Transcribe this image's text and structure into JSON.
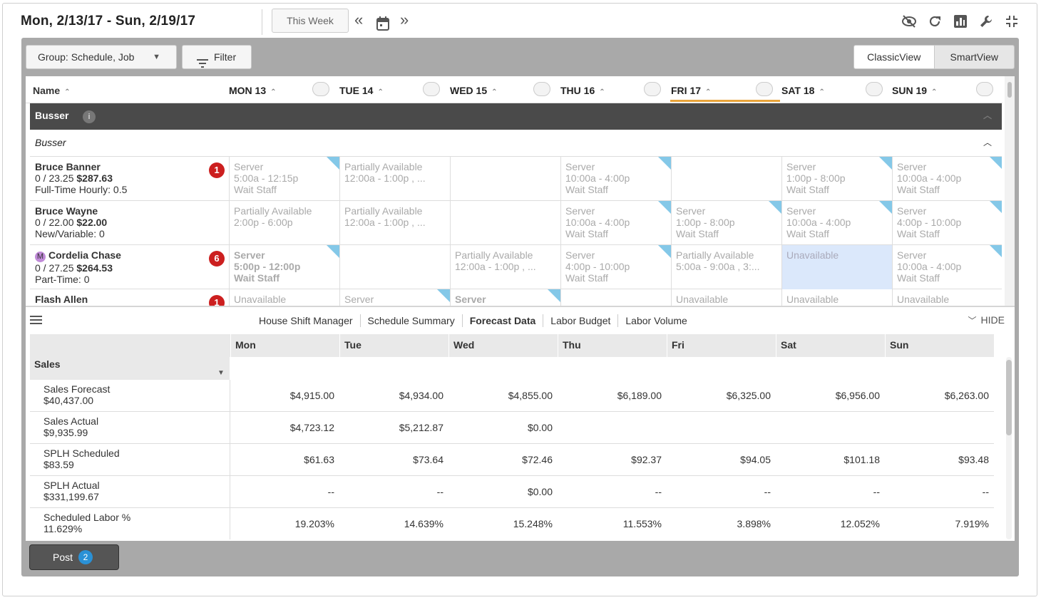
{
  "header": {
    "date_range": "Mon, 2/13/17 - Sun, 2/19/17",
    "this_week": "This Week",
    "prev_icon": "«",
    "next_icon": "»"
  },
  "toolbar": {
    "group_label": "Group: Schedule, Job",
    "filter_label": "Filter",
    "classic_view": "ClassicView",
    "smart_view": "SmartView"
  },
  "schedule": {
    "name_header": "Name",
    "days": [
      "MON 13",
      "TUE 14",
      "WED 15",
      "THU 16",
      "FRI 17",
      "SAT 18",
      "SUN 19"
    ],
    "group_title": "Busser",
    "subgroup_title": "Busser",
    "employees": [
      {
        "name": "Bruce Banner",
        "hours": "0 / 23.25",
        "cost": "$287.63",
        "type": "Full-Time Hourly: 0.5",
        "badge": "1",
        "manager": "",
        "cells": [
          {
            "l1": "Server",
            "l2": "5:00a - 12:15p",
            "l3": "Wait Staff",
            "corner": true
          },
          {
            "l1": "Partially Available",
            "l2": "12:00a - 1:00p , ...",
            "l3": ""
          },
          {
            "l1": "",
            "l2": "",
            "l3": ""
          },
          {
            "l1": "Server",
            "l2": "10:00a - 4:00p",
            "l3": "Wait Staff",
            "corner": true
          },
          {
            "l1": "",
            "l2": "",
            "l3": ""
          },
          {
            "l1": "Server",
            "l2": "1:00p - 8:00p",
            "l3": "Wait Staff",
            "corner": true
          },
          {
            "l1": "Server",
            "l2": "10:00a - 4:00p",
            "l3": "Wait Staff",
            "corner": true
          }
        ]
      },
      {
        "name": "Bruce Wayne",
        "hours": "0 / 22.00",
        "cost": "$22.00",
        "type": "New/Variable: 0",
        "badge": "",
        "manager": "",
        "cells": [
          {
            "l1": "Partially Available",
            "l2": "2:00p - 6:00p",
            "l3": ""
          },
          {
            "l1": "Partially Available",
            "l2": "12:00a - 1:00p , ...",
            "l3": ""
          },
          {
            "l1": "",
            "l2": "",
            "l3": ""
          },
          {
            "l1": "Server",
            "l2": "10:00a - 4:00p",
            "l3": "Wait Staff",
            "corner": true
          },
          {
            "l1": "Server",
            "l2": "1:00p - 8:00p",
            "l3": "Wait Staff",
            "corner": true
          },
          {
            "l1": "Server",
            "l2": "10:00a - 4:00p",
            "l3": "Wait Staff",
            "corner": true
          },
          {
            "l1": "Server",
            "l2": "4:00p - 10:00p",
            "l3": "Wait Staff",
            "corner": true
          }
        ]
      },
      {
        "name": "Cordelia Chase",
        "hours": "0 / 27.25",
        "cost": "$264.53",
        "type": "Part-Time: 0",
        "badge": "6",
        "manager": "M",
        "cells": [
          {
            "l1": "Server",
            "l2": "5:00p - 12:00p",
            "l3": "Wait Staff",
            "corner": true,
            "bold": true
          },
          {
            "l1": "",
            "l2": "",
            "l3": ""
          },
          {
            "l1": "Partially Available",
            "l2": "12:00a - 1:00p , ...",
            "l3": ""
          },
          {
            "l1": "Server",
            "l2": "4:00p - 10:00p",
            "l3": "Wait Staff",
            "corner": true
          },
          {
            "l1": "Partially Available",
            "l2": "5:00a - 9:00a , 3:...",
            "l3": ""
          },
          {
            "l1": "Unavailable",
            "l2": "",
            "l3": "",
            "unavail": true
          },
          {
            "l1": "Server",
            "l2": "10:00a - 4:00p",
            "l3": "Wait Staff",
            "corner": true
          }
        ]
      },
      {
        "name": "Flash Allen",
        "hours": "",
        "cost": "",
        "type": "",
        "badge": "1",
        "manager": "",
        "cells": [
          {
            "l1": "Unavailable",
            "l2": "",
            "l3": ""
          },
          {
            "l1": "Server",
            "l2": "",
            "l3": "",
            "corner": true
          },
          {
            "l1": "Server",
            "l2": "",
            "l3": "",
            "corner": true,
            "bold": true
          },
          {
            "l1": "",
            "l2": "",
            "l3": ""
          },
          {
            "l1": "Unavailable",
            "l2": "",
            "l3": ""
          },
          {
            "l1": "Unavailable",
            "l2": "",
            "l3": ""
          },
          {
            "l1": "Unavailable",
            "l2": "",
            "l3": ""
          }
        ]
      }
    ]
  },
  "tabs": {
    "items": [
      "House Shift Manager",
      "Schedule Summary",
      "Forecast Data",
      "Labor Budget",
      "Labor Volume"
    ],
    "active": "Forecast Data",
    "hide_label": "HIDE"
  },
  "forecast": {
    "columns": [
      "Mon",
      "Tue",
      "Wed",
      "Thu",
      "Fri",
      "Sat",
      "Sun"
    ],
    "section_title": "Sales",
    "rows": [
      {
        "label": "Sales Forecast",
        "total": "$40,437.00",
        "values": [
          "$4,915.00",
          "$4,934.00",
          "$4,855.00",
          "$6,189.00",
          "$6,325.00",
          "$6,956.00",
          "$6,263.00"
        ]
      },
      {
        "label": "Sales Actual",
        "total": "$9,935.99",
        "values": [
          "$4,723.12",
          "$5,212.87",
          "$0.00",
          "",
          "",
          "",
          ""
        ]
      },
      {
        "label": "SPLH Scheduled",
        "total": "$83.59",
        "values": [
          "$61.63",
          "$73.64",
          "$72.46",
          "$92.37",
          "$94.05",
          "$101.18",
          "$93.48"
        ]
      },
      {
        "label": "SPLH Actual",
        "total": "$331,199.67",
        "values": [
          "--",
          "--",
          "$0.00",
          "--",
          "--",
          "--",
          "--"
        ]
      },
      {
        "label": "Scheduled Labor %",
        "total": "11.629%",
        "values": [
          "19.203%",
          "14.639%",
          "15.248%",
          "11.553%",
          "3.898%",
          "12.052%",
          "7.919%"
        ]
      }
    ]
  },
  "footer": {
    "post_label": "Post",
    "post_count": "2"
  },
  "colors": {
    "accent_underline": "#e8a33a",
    "badge_red": "#cc1f1f",
    "corner_blue": "#84c8e8",
    "unavailable_bg": "#dbe8fb",
    "post_badge": "#2a91d6"
  }
}
